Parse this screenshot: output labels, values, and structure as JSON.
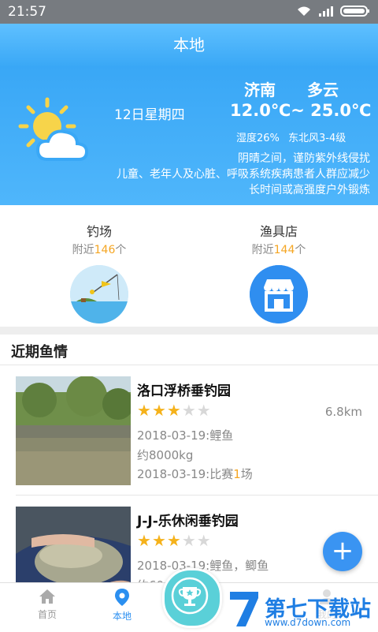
{
  "status_bar": {
    "time": "21:57"
  },
  "header": {
    "title": "本地"
  },
  "weather": {
    "date": "12日星期四",
    "city": "济南",
    "condition": "多云",
    "temperature": "12.0℃~ 25.0℃",
    "humidity": "湿度26%",
    "wind": "东北风3-4级",
    "advice_line1": "阴晴之间，谨防紫外线侵扰",
    "advice_line2": "儿童、老年人及心脏、呼吸系统疾病患者人群应减少",
    "advice_line3": "长时间或高强度户外锻炼"
  },
  "nearby": [
    {
      "label": "钓场",
      "prefix": "附近",
      "count": "146",
      "suffix": "个",
      "icon": "fishing-spot-icon"
    },
    {
      "label": "渔具店",
      "prefix": "附近",
      "count": "144",
      "suffix": "个",
      "icon": "shop-icon"
    }
  ],
  "section": {
    "title": "近期鱼情"
  },
  "listings": [
    {
      "name": "洛口浮桥垂钓园",
      "rating": 3,
      "max_rating": 5,
      "distance": "6.8km",
      "line1": "2018-03-19:鲤鱼",
      "line2": "约8000kg",
      "line3_prefix": "2018-03-19:比赛",
      "line3_count": "1",
      "line3_suffix": "场"
    },
    {
      "name": "J-J-乐休闲垂钓园",
      "rating": 3,
      "max_rating": 5,
      "distance": "",
      "line1": "2018-03-19:鲤鱼，鲫鱼",
      "line2": "约60"
    }
  ],
  "fab": {
    "label": "+"
  },
  "tabs": [
    {
      "label": "首页",
      "icon": "home-icon",
      "active": false
    },
    {
      "label": "本地",
      "icon": "location-pin-icon",
      "active": true
    },
    {
      "label": "",
      "icon": "trophy-icon",
      "active": false
    },
    {
      "label": "我的",
      "icon": "user-icon",
      "active": false
    }
  ],
  "watermark": {
    "brand": "第七下载站",
    "url": "www.d7down.com"
  },
  "colors": {
    "primary": "#3aa8f6",
    "accent": "#f5a623",
    "star": "#f5b21b",
    "fab": "#3a94f2"
  }
}
